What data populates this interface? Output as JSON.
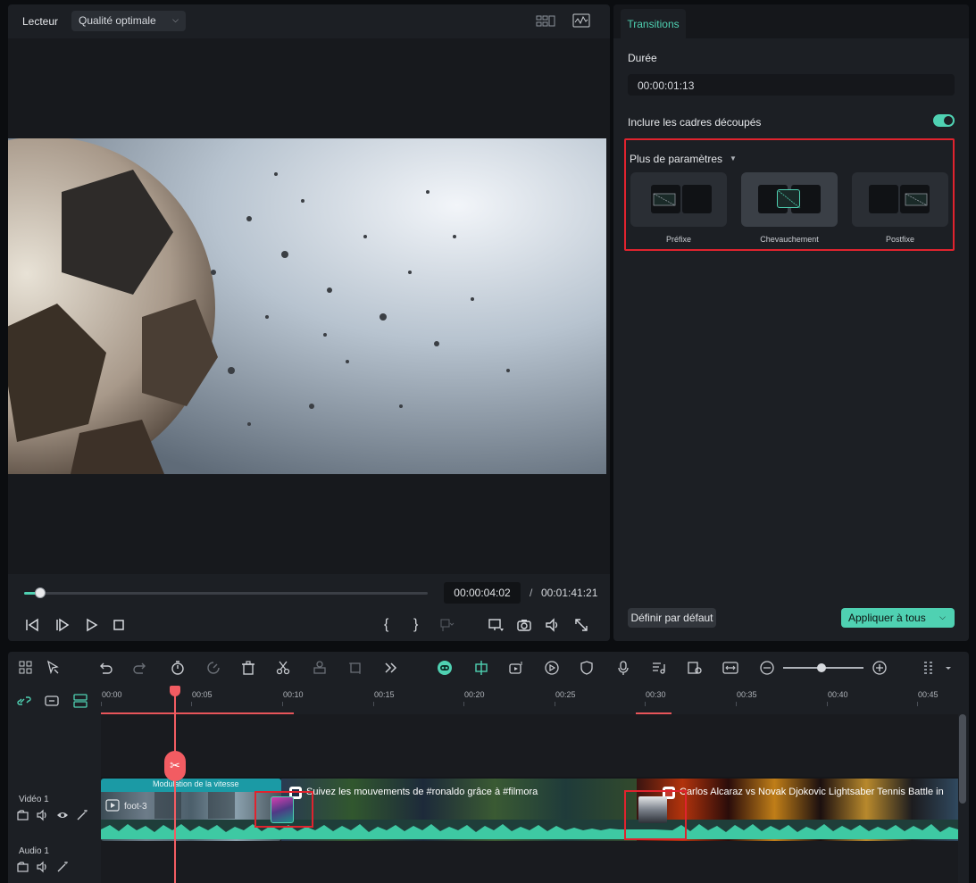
{
  "player": {
    "title": "Lecteur",
    "quality": "Qualité optimale",
    "progress_fraction": 0.04,
    "current_time": "00:00:04:02",
    "time_separator": "/",
    "total_time": "00:01:41:21",
    "controls": {
      "brace_open": "{",
      "brace_close": "}"
    }
  },
  "transitions_panel": {
    "tab": "Transitions",
    "duration_label": "Durée",
    "duration_value": "00:00:01:13",
    "include_trimmed_label": "Inclure les cadres découpés",
    "include_trimmed_on": true,
    "more_params_label": "Plus de paramètres",
    "modes": [
      {
        "label": "Préfixe",
        "selected": false
      },
      {
        "label": "Chevauchement",
        "selected": true
      },
      {
        "label": "Postfixe",
        "selected": false
      }
    ],
    "reset_label": "Définir par défaut",
    "apply_all_label": "Appliquer à tous"
  },
  "timeline": {
    "ruler": [
      "00:00",
      "00:05",
      "00:10",
      "00:15",
      "00:20",
      "00:25",
      "00:30",
      "00:35",
      "00:40",
      "00:45"
    ],
    "tracks": {
      "video_label": "Vidéo 1",
      "audio_label": "Audio 1"
    },
    "clips": {
      "speed_tag": "Modulation de la vitesse",
      "clip1_name": "foot-3",
      "clip2_title": "Suivez les mouvements de #ronaldo grâce à #filmora",
      "clip3_title": "Carlos Alcaraz vs Novak Djokovic Lightsaber Tennis Battle in"
    }
  },
  "colors": {
    "accent": "#4fd1b2",
    "highlight_box": "#e0232e",
    "playhead": "#f25c62"
  }
}
